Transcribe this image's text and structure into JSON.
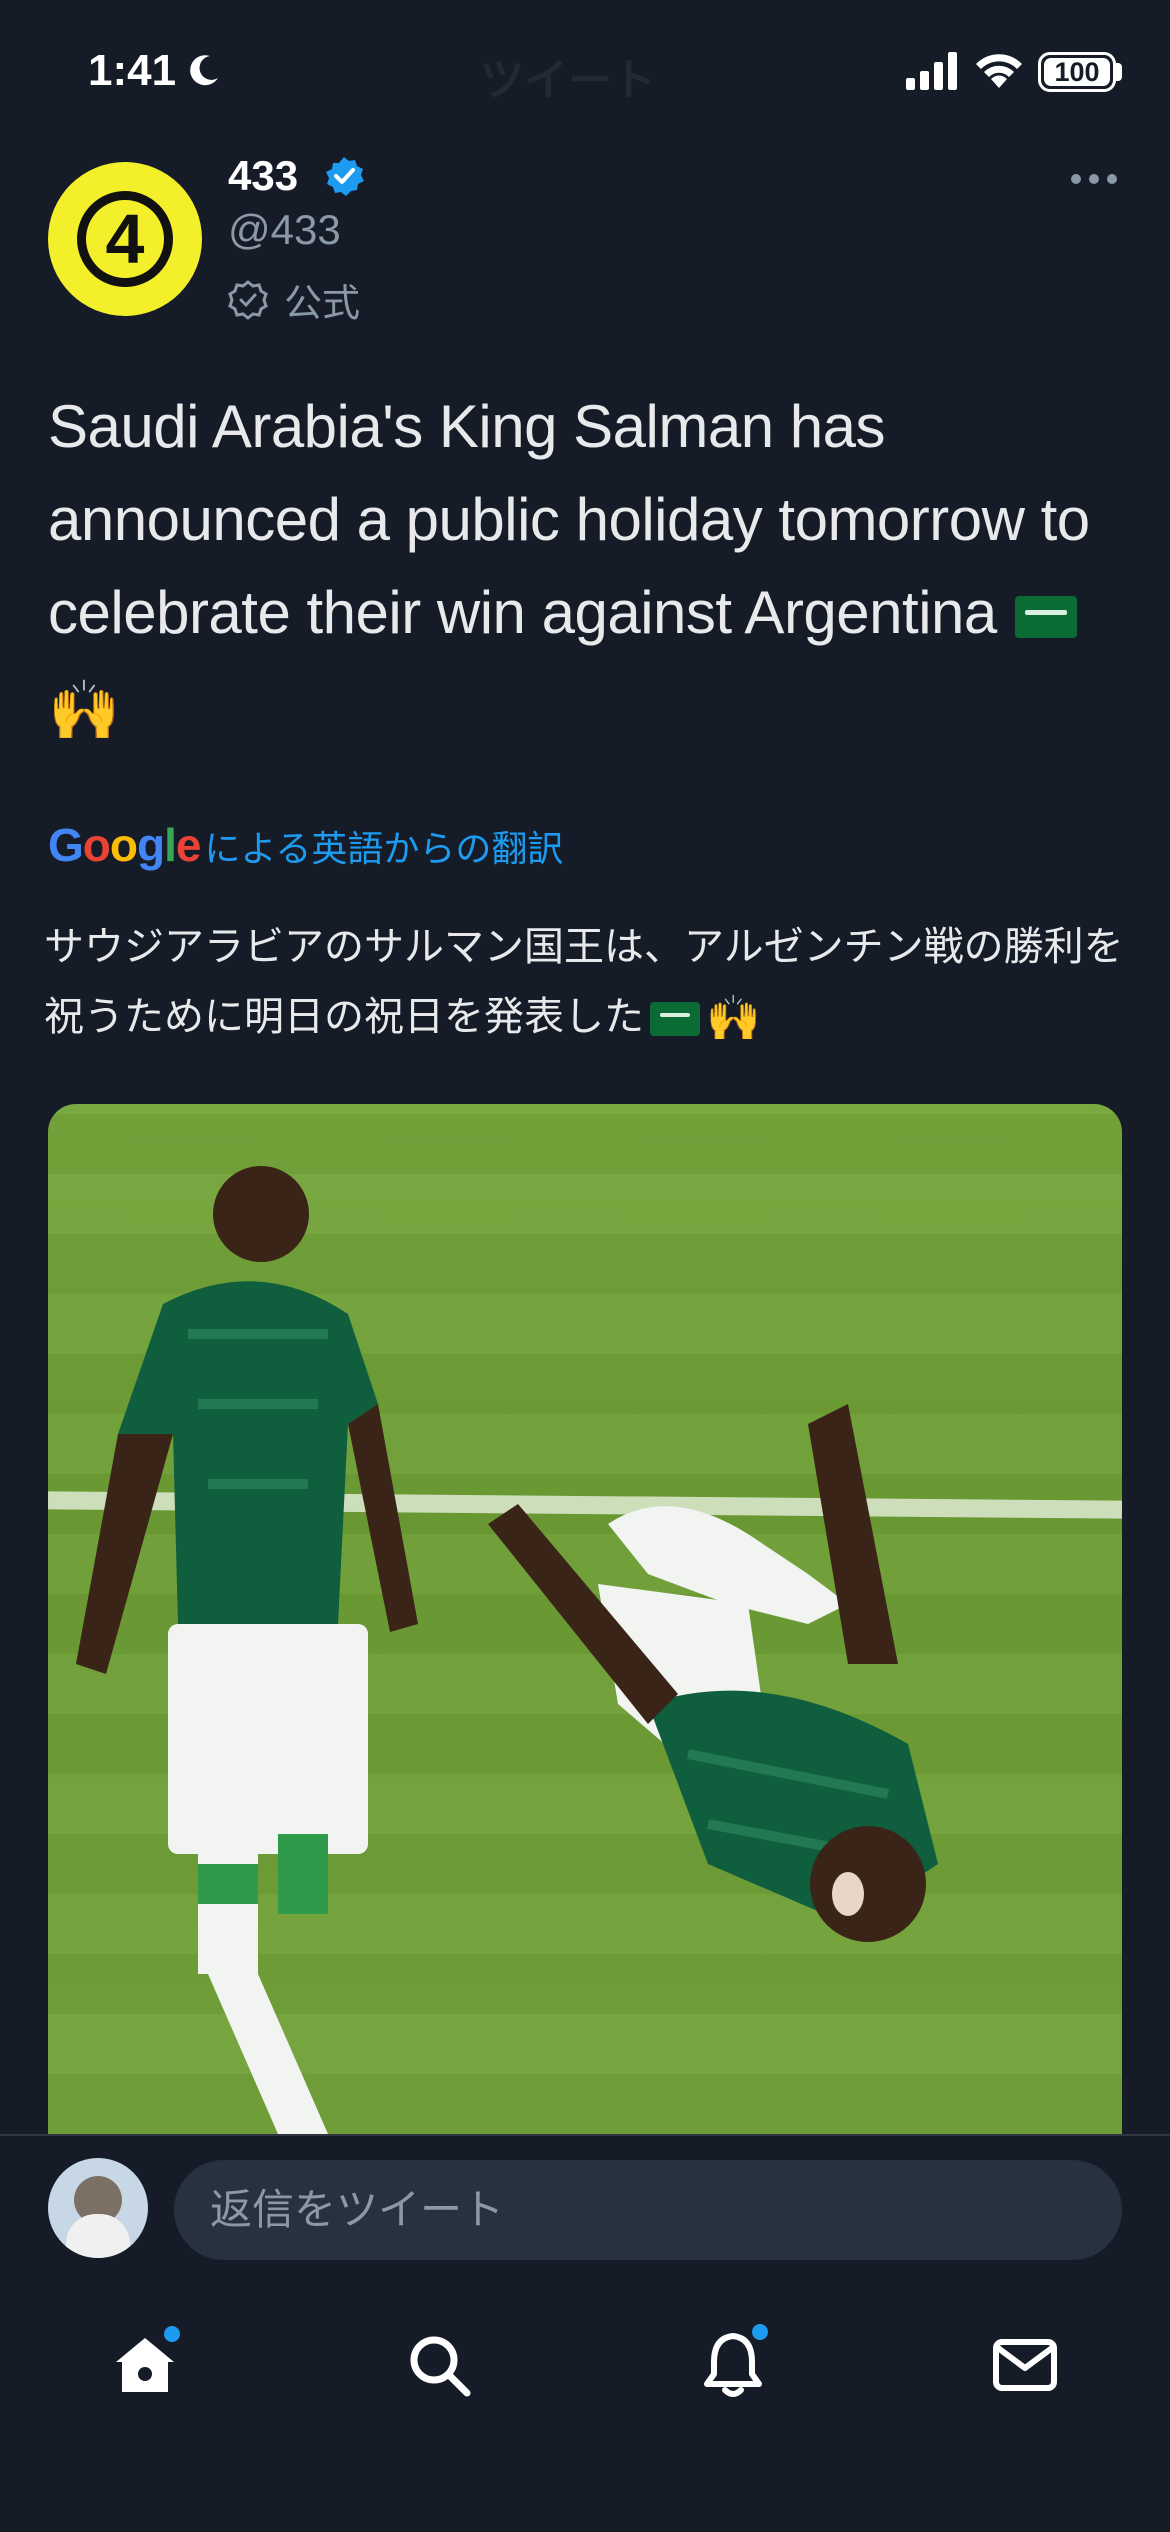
{
  "status": {
    "time": "1:41",
    "battery": "100",
    "ghost_title": "ツイート"
  },
  "tweet": {
    "display_name": "433",
    "handle": "@433",
    "official_label": "公式",
    "avatar_text": "4",
    "text": "Saudi Arabia's King Salman has announced a public holiday tomorrow to celebrate their win against Argentina",
    "emoji": "🙌",
    "translation_brand": "Google",
    "translation_label": "による英語からの翻訳",
    "translated_text": "サウジアラビアのサルマン国王は、アルゼンチン戦の勝利を祝うために明日の祝日を発表した"
  },
  "reply": {
    "placeholder": "返信をツイート"
  },
  "colors": {
    "background": "#151c28",
    "accent": "#1d9bf0",
    "avatar_yellow": "#f3ef2a",
    "muted": "#8b98a5"
  },
  "tabs": [
    {
      "icon": "home-icon",
      "has_dot": true
    },
    {
      "icon": "search-icon",
      "has_dot": false
    },
    {
      "icon": "bell-icon",
      "has_dot": true
    },
    {
      "icon": "mail-icon",
      "has_dot": false
    }
  ]
}
